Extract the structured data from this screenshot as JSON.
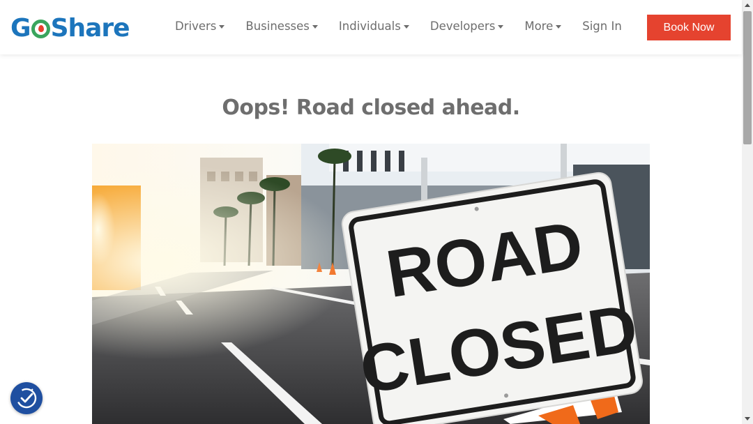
{
  "header": {
    "logo": {
      "part_go": "G",
      "part_o": "o",
      "part_share": "Share",
      "icon": "map-pin-icon"
    },
    "nav": [
      {
        "label": "Drivers",
        "has_dropdown": true
      },
      {
        "label": "Businesses",
        "has_dropdown": true
      },
      {
        "label": "Individuals",
        "has_dropdown": true
      },
      {
        "label": "Developers",
        "has_dropdown": true
      },
      {
        "label": "More",
        "has_dropdown": true
      },
      {
        "label": "Sign In",
        "has_dropdown": false
      }
    ],
    "cta_label": "Book Now"
  },
  "main": {
    "headline": "Oops! Road closed ahead.",
    "hero_sign": {
      "line1": "ROAD",
      "line2": "CLOSED"
    }
  },
  "accessibility_widget": {
    "icon": "accessibility-check-icon"
  },
  "colors": {
    "brand_blue": "#1c75bc",
    "brand_green": "#3aa55d",
    "accent_red": "#e5432f",
    "headline_gray": "#6e6e6e",
    "nav_gray": "#6d6d6d",
    "a11y_blue": "#1f4fa0"
  }
}
